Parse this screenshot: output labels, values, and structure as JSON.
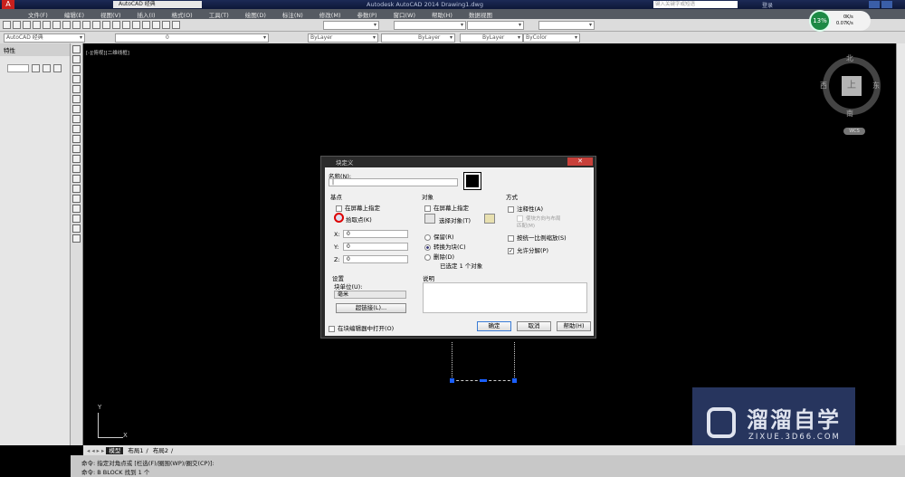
{
  "titlebar": {
    "workspace": "AutoCAD 经典",
    "title": "Autodesk AutoCAD 2014    Drawing1.dwg",
    "search_placeholder": "键入关键字或短语",
    "login": "登录"
  },
  "menu": [
    "文件(F)",
    "编辑(E)",
    "视图(V)",
    "插入(I)",
    "格式(O)",
    "工具(T)",
    "绘图(D)",
    "标注(N)",
    "修改(M)",
    "参数(P)",
    "窗口(W)",
    "帮助(H)",
    "数据视图"
  ],
  "toolbar": {
    "workspace_combo": "AutoCAD 经典",
    "layer_combo": "0",
    "color_combo": "ByLayer",
    "linetype_combo": "ByLayer",
    "lineweight_combo": "ByLayer",
    "plotstyle_combo": "ByColor"
  },
  "net_widget": {
    "percent": "13%",
    "up": "0K/s",
    "down": "0.07K/s"
  },
  "palette": {
    "title": "特性"
  },
  "viewport": {
    "label": "[-][俯视][二维线框]",
    "compass": {
      "n": "北",
      "s": "南",
      "e": "东",
      "w": "西",
      "top": "上",
      "wcs": "WCS"
    },
    "ucs_x": "X",
    "ucs_y": "Y"
  },
  "tabs": [
    "模型",
    "布局1",
    "布局2"
  ],
  "command": [
    "命令: 指定对角点或 [栏选(F)/圈围(WP)/圈交(CP)]:",
    "命令: B BLOCK 找到 1 个"
  ],
  "dialog": {
    "title": "块定义",
    "name_label": "名称(N):",
    "name_value": "|",
    "base": {
      "title": "基点",
      "onscreen": "在屏幕上指定",
      "pick": "拾取点(K)",
      "x_label": "X:",
      "x": "0",
      "y_label": "Y:",
      "y": "0",
      "z_label": "Z:",
      "z": "0"
    },
    "objects": {
      "title": "对象",
      "onscreen": "在屏幕上指定",
      "select": "选择对象(T)",
      "retain": "保留(R)",
      "convert": "转换为块(C)",
      "delete": "删除(D)",
      "selected": "已选定 1 个对象",
      "selected_option": "convert"
    },
    "behavior": {
      "title": "方式",
      "annotative": "注释性(A)",
      "match": "使块方向与布局匹配(M)",
      "uniform": "按统一比例缩放(S)",
      "explode": "允许分解(P)",
      "explode_checked": true
    },
    "settings": {
      "title": "设置",
      "unit_label": "块单位(U):",
      "unit": "毫米",
      "hyperlink": "超链接(L)..."
    },
    "description": {
      "title": "说明"
    },
    "open_in_editor": "在块编辑器中打开(O)",
    "ok": "确定",
    "cancel": "取消",
    "help": "帮助(H)"
  },
  "watermark": {
    "text": "溜溜自学",
    "url": "ZIXUE.3D66.COM"
  }
}
